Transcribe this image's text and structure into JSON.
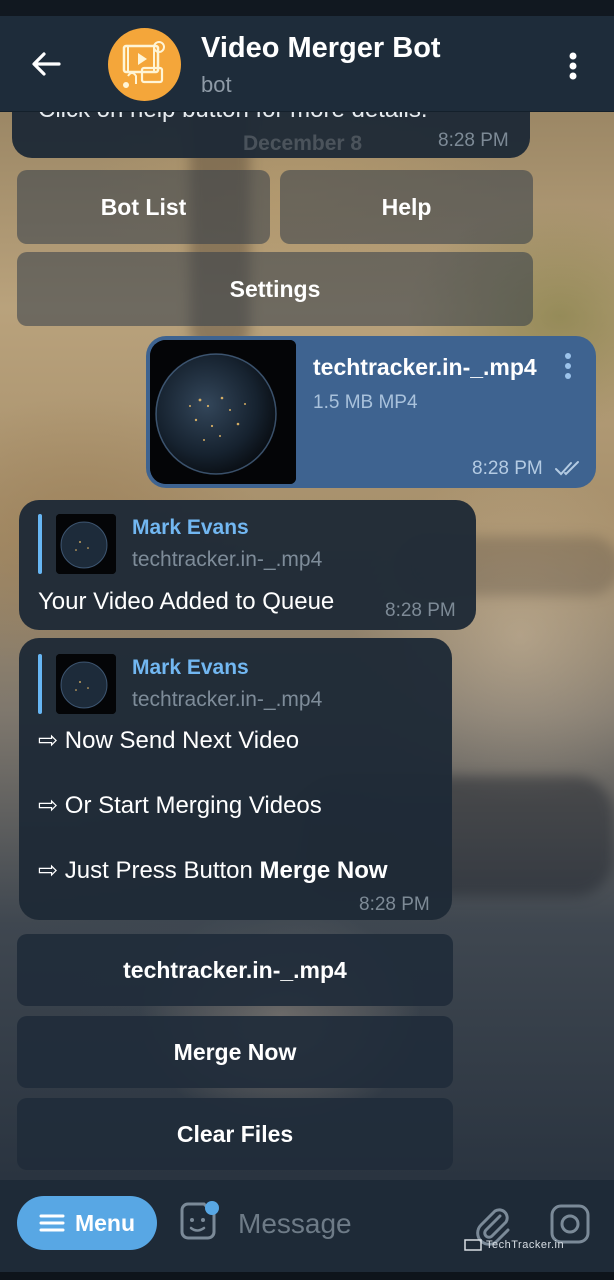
{
  "header": {
    "title": "Video Merger Bot",
    "subtitle": "bot",
    "avatar_icon": "video-merge-icon",
    "accent": "#f4a63a"
  },
  "messages": {
    "intro": {
      "text": "Click on help button for more details.",
      "date_overlay": "December 8",
      "time": "8:28 PM"
    },
    "keyboard_top": {
      "bot_list": "Bot List",
      "help": "Help",
      "settings": "Settings"
    },
    "file_message": {
      "file_name": "techtracker.in-_.mp4",
      "file_info": "1.5 MB MP4",
      "time": "8:28 PM",
      "status_icon": "double-check-icon"
    },
    "reply1": {
      "reply_name": "Mark Evans",
      "reply_file": "techtracker.in-_.mp4",
      "text": "Your Video Added to Queue",
      "time": "8:28 PM"
    },
    "reply2": {
      "reply_name": "Mark Evans",
      "reply_file": "techtracker.in-_.mp4",
      "line1": "⇨ Now Send Next Video",
      "line2": "⇨ Or Start Merging Videos",
      "line3_prefix": "⇨ Just Press Button ",
      "line3_bold": "Merge Now",
      "time": "8:28 PM"
    },
    "keyboard_bottom": {
      "file_button": "techtracker.in-_.mp4",
      "merge_now": "Merge Now",
      "clear_files": "Clear Files"
    }
  },
  "composer": {
    "menu_label": "Menu",
    "placeholder": "Message"
  },
  "watermark": "TechTracker.in",
  "colors": {
    "header_bg": "#1e2c3a",
    "incoming_bubble": "#1e2a36",
    "outgoing_bubble": "#3e6390",
    "link_blue": "#72b7f1",
    "menu_button": "#58a7e4"
  }
}
